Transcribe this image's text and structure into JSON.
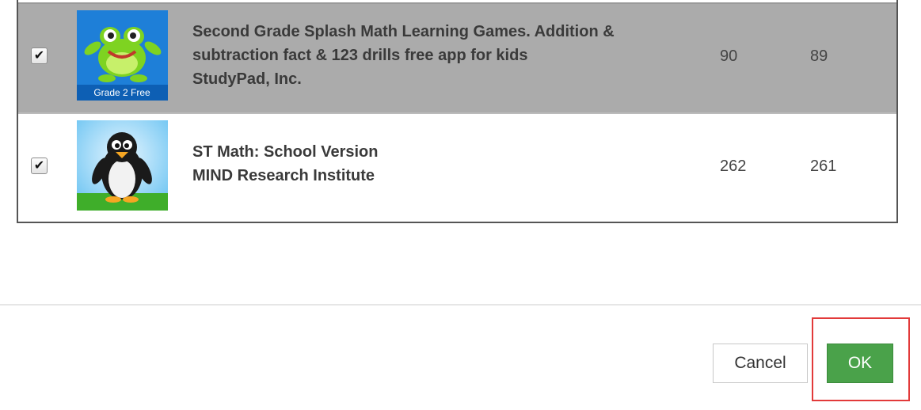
{
  "apps": [
    {
      "checked": true,
      "title_line1": "Second Grade Splash Math Learning Games. Addition &",
      "title_line2": "subtraction fact & 123 drills free app for kids",
      "developer": "StudyPad, Inc.",
      "value_a": "90",
      "value_b": "89",
      "icon_caption": "Grade 2 Free",
      "icon_name": "frog-grade2-app-icon"
    },
    {
      "checked": true,
      "title_line1": "ST Math: School Version",
      "developer": "MIND Research Institute",
      "value_a": "262",
      "value_b": "261",
      "icon_name": "penguin-app-icon"
    }
  ],
  "footer": {
    "cancel_label": "Cancel",
    "ok_label": "OK"
  },
  "colors": {
    "selected_row": "#ababab",
    "ok_button": "#4aa24a",
    "highlight": "#e23a3a"
  }
}
